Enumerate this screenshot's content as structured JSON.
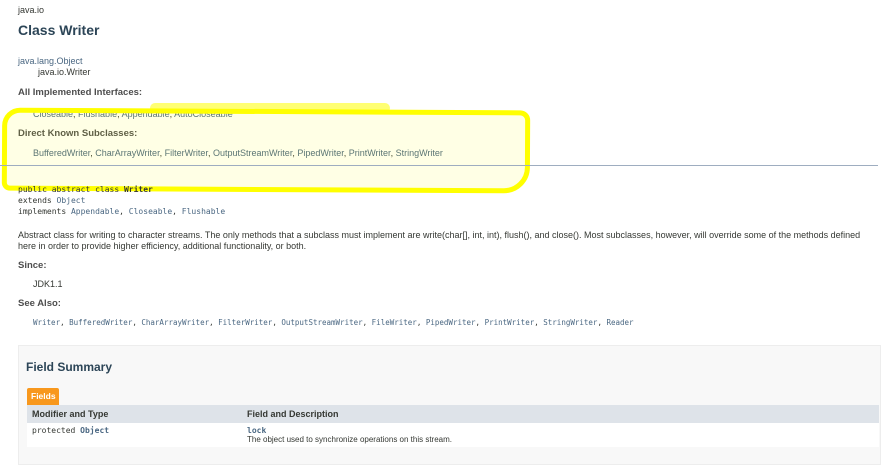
{
  "package": "java.io",
  "class_title": "Class Writer",
  "inheritance": {
    "parent": "java.lang.Object",
    "child": "java.io.Writer"
  },
  "all_implemented_interfaces": {
    "heading": "All Implemented Interfaces:",
    "items": [
      "Closeable",
      "Flushable",
      "Appendable",
      "AutoCloseable"
    ]
  },
  "direct_known_subclasses": {
    "heading": "Direct Known Subclasses:",
    "items": [
      "BufferedWriter",
      "CharArrayWriter",
      "FilterWriter",
      "OutputStreamWriter",
      "PipedWriter",
      "PrintWriter",
      "StringWriter"
    ]
  },
  "declaration": {
    "line1_prefix": "public abstract class ",
    "line1_name": "Writer",
    "line2_prefix": "extends ",
    "line2_link": "Object",
    "line3_prefix": "implements ",
    "line3_links": [
      "Appendable",
      "Closeable",
      "Flushable"
    ]
  },
  "description": "Abstract class for writing to character streams. The only methods that a subclass must implement are write(char[], int, int), flush(), and close(). Most subclasses, however, will override some of the methods defined here in order to provide higher efficiency, additional functionality, or both.",
  "since": {
    "heading": "Since:",
    "value": "JDK1.1"
  },
  "see_also": {
    "heading": "See Also:",
    "items": [
      "Writer",
      "BufferedWriter",
      "CharArrayWriter",
      "FilterWriter",
      "OutputStreamWriter",
      "FileWriter",
      "PipedWriter",
      "PrintWriter",
      "StringWriter",
      "Reader"
    ]
  },
  "field_summary": {
    "title": "Field Summary",
    "tab_label": "Fields",
    "col_modifier": "Modifier and Type",
    "col_field": "Field and Description",
    "rows": [
      {
        "modifier_prefix": "protected ",
        "modifier_type": "Object",
        "field": "lock",
        "description": "The object used to synchronize operations on this stream."
      }
    ]
  },
  "colors": {
    "link": "#4a6782",
    "highlight": "#ffff00",
    "tab": "#f8981d",
    "table_header": "#dee3e9"
  }
}
